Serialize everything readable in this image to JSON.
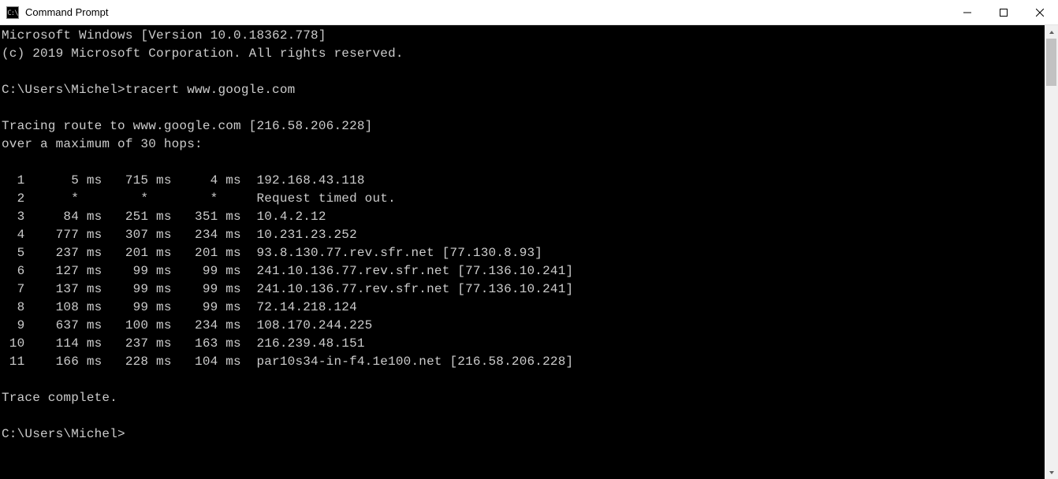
{
  "window": {
    "title": "Command Prompt",
    "icon_glyph": "C:\\"
  },
  "terminal": {
    "lines": {
      "ver": "Microsoft Windows [Version 10.0.18362.778]",
      "copy": "(c) 2019 Microsoft Corporation. All rights reserved.",
      "blank1": "",
      "prompt1": "C:\\Users\\Michel>tracert www.google.com",
      "blank2": "",
      "trace1": "Tracing route to www.google.com [216.58.206.228]",
      "trace2": "over a maximum of 30 hops:",
      "blank3": ""
    },
    "hops": [
      {
        "n": "1",
        "t1": "5 ms",
        "t2": "715 ms",
        "t3": "4 ms",
        "host": "192.168.43.118"
      },
      {
        "n": "2",
        "t1": "*",
        "t2": "*",
        "t3": "*",
        "host": "Request timed out."
      },
      {
        "n": "3",
        "t1": "84 ms",
        "t2": "251 ms",
        "t3": "351 ms",
        "host": "10.4.2.12"
      },
      {
        "n": "4",
        "t1": "777 ms",
        "t2": "307 ms",
        "t3": "234 ms",
        "host": "10.231.23.252"
      },
      {
        "n": "5",
        "t1": "237 ms",
        "t2": "201 ms",
        "t3": "201 ms",
        "host": "93.8.130.77.rev.sfr.net [77.130.8.93]"
      },
      {
        "n": "6",
        "t1": "127 ms",
        "t2": "99 ms",
        "t3": "99 ms",
        "host": "241.10.136.77.rev.sfr.net [77.136.10.241]"
      },
      {
        "n": "7",
        "t1": "137 ms",
        "t2": "99 ms",
        "t3": "99 ms",
        "host": "241.10.136.77.rev.sfr.net [77.136.10.241]"
      },
      {
        "n": "8",
        "t1": "108 ms",
        "t2": "99 ms",
        "t3": "99 ms",
        "host": "72.14.218.124"
      },
      {
        "n": "9",
        "t1": "637 ms",
        "t2": "100 ms",
        "t3": "234 ms",
        "host": "108.170.244.225"
      },
      {
        "n": "10",
        "t1": "114 ms",
        "t2": "237 ms",
        "t3": "163 ms",
        "host": "216.239.48.151"
      },
      {
        "n": "11",
        "t1": "166 ms",
        "t2": "228 ms",
        "t3": "104 ms",
        "host": "par10s34-in-f4.1e100.net [216.58.206.228]"
      }
    ],
    "tail": {
      "blank4": "",
      "complete": "Trace complete.",
      "blank5": "",
      "prompt2": "C:\\Users\\Michel>"
    }
  }
}
